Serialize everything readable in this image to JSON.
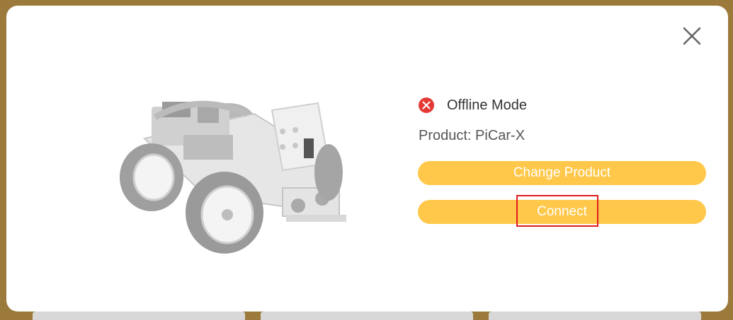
{
  "dialog": {
    "status_label": "Offline Mode",
    "status_icon": "error-x-icon",
    "status_color": "#e53935",
    "product_text": "Product: PiCar-X",
    "change_product_label": "Change Product",
    "connect_label": "Connect",
    "button_color": "#ffc84a",
    "highlight_color": "#e01b1b"
  },
  "icons": {
    "close": "close-icon",
    "robot": "robot-car-image"
  }
}
